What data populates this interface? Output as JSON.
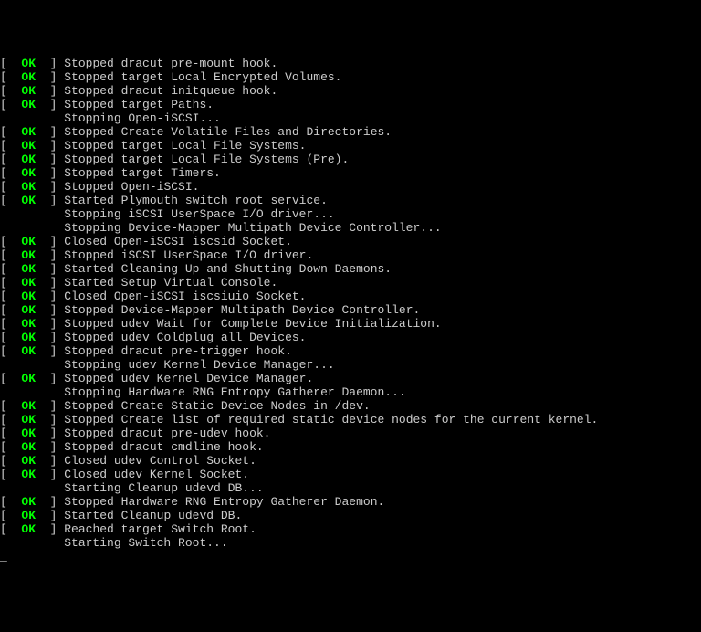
{
  "lines": [
    {
      "status": "OK",
      "message": "Stopped dracut pre-mount hook."
    },
    {
      "status": "OK",
      "message": "Stopped target Local Encrypted Volumes."
    },
    {
      "status": "OK",
      "message": "Stopped dracut initqueue hook."
    },
    {
      "status": "OK",
      "message": "Stopped target Paths."
    },
    {
      "status": null,
      "message": "Stopping Open-iSCSI..."
    },
    {
      "status": "OK",
      "message": "Stopped Create Volatile Files and Directories."
    },
    {
      "status": "OK",
      "message": "Stopped target Local File Systems."
    },
    {
      "status": "OK",
      "message": "Stopped target Local File Systems (Pre)."
    },
    {
      "status": "OK",
      "message": "Stopped target Timers."
    },
    {
      "status": "OK",
      "message": "Stopped Open-iSCSI."
    },
    {
      "status": "OK",
      "message": "Started Plymouth switch root service."
    },
    {
      "status": null,
      "message": "Stopping iSCSI UserSpace I/O driver..."
    },
    {
      "status": null,
      "message": "Stopping Device-Mapper Multipath Device Controller..."
    },
    {
      "status": "OK",
      "message": "Closed Open-iSCSI iscsid Socket."
    },
    {
      "status": "OK",
      "message": "Stopped iSCSI UserSpace I/O driver."
    },
    {
      "status": "OK",
      "message": "Started Cleaning Up and Shutting Down Daemons."
    },
    {
      "status": "OK",
      "message": "Started Setup Virtual Console."
    },
    {
      "status": "OK",
      "message": "Closed Open-iSCSI iscsiuio Socket."
    },
    {
      "status": "OK",
      "message": "Stopped Device-Mapper Multipath Device Controller."
    },
    {
      "status": "OK",
      "message": "Stopped udev Wait for Complete Device Initialization."
    },
    {
      "status": "OK",
      "message": "Stopped udev Coldplug all Devices."
    },
    {
      "status": "OK",
      "message": "Stopped dracut pre-trigger hook."
    },
    {
      "status": null,
      "message": "Stopping udev Kernel Device Manager..."
    },
    {
      "status": "OK",
      "message": "Stopped udev Kernel Device Manager."
    },
    {
      "status": null,
      "message": "Stopping Hardware RNG Entropy Gatherer Daemon..."
    },
    {
      "status": "OK",
      "message": "Stopped Create Static Device Nodes in /dev."
    },
    {
      "status": "OK",
      "message": "Stopped Create list of required static device nodes for the current kernel."
    },
    {
      "status": "OK",
      "message": "Stopped dracut pre-udev hook."
    },
    {
      "status": "OK",
      "message": "Stopped dracut cmdline hook."
    },
    {
      "status": "OK",
      "message": "Closed udev Control Socket."
    },
    {
      "status": "OK",
      "message": "Closed udev Kernel Socket."
    },
    {
      "status": null,
      "message": "Starting Cleanup udevd DB..."
    },
    {
      "status": "OK",
      "message": "Stopped Hardware RNG Entropy Gatherer Daemon."
    },
    {
      "status": "OK",
      "message": "Started Cleanup udevd DB."
    },
    {
      "status": "OK",
      "message": "Reached target Switch Root."
    },
    {
      "status": null,
      "message": "Starting Switch Root..."
    }
  ],
  "cursor": "_"
}
